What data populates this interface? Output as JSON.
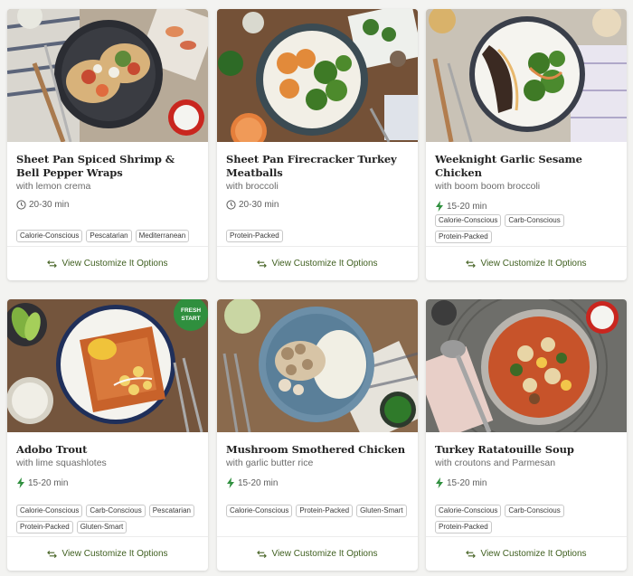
{
  "colors": {
    "accent_green": "#4a6628",
    "bolt_green": "#2f8f3e",
    "tag_border": "#c9c9c9"
  },
  "recipes": [
    {
      "title": "Sheet Pan Spiced Shrimp & Bell Pepper Wraps",
      "subtitle": "with lemon crema",
      "time": "20-30 min",
      "time_icon": "clock-icon",
      "tags": [
        "Calorie-Conscious",
        "Pescatarian",
        "Mediterranean"
      ],
      "action": "View Customize It Options"
    },
    {
      "title": "Sheet Pan Firecracker Turkey Meatballs",
      "subtitle": "with broccoli",
      "time": "20-30 min",
      "time_icon": "clock-icon",
      "tags": [
        "Protein-Packed"
      ],
      "action": "View Customize It Options"
    },
    {
      "title": "Weeknight Garlic Sesame Chicken",
      "subtitle": "with boom boom broccoli",
      "time": "15-20 min",
      "time_icon": "lightning-bolt-icon",
      "tags": [
        "Calorie-Conscious",
        "Carb-Conscious",
        "Protein-Packed"
      ],
      "action": "View Customize It Options"
    },
    {
      "title": "Adobo Trout",
      "subtitle": "with lime squashlotes",
      "time": "15-20 min",
      "time_icon": "lightning-bolt-icon",
      "tags": [
        "Calorie-Conscious",
        "Carb-Conscious",
        "Pescatarian",
        "Protein-Packed",
        "Gluten-Smart"
      ],
      "badge": "FRESH START",
      "action": "View Customize It Options"
    },
    {
      "title": "Mushroom Smothered Chicken",
      "subtitle": "with garlic butter rice",
      "time": "15-20 min",
      "time_icon": "lightning-bolt-icon",
      "tags": [
        "Calorie-Conscious",
        "Protein-Packed",
        "Gluten-Smart"
      ],
      "action": "View Customize It Options"
    },
    {
      "title": "Turkey Ratatouille Soup",
      "subtitle": "with croutons and Parmesan",
      "time": "15-20 min",
      "time_icon": "lightning-bolt-icon",
      "tags": [
        "Calorie-Conscious",
        "Carb-Conscious",
        "Protein-Packed"
      ],
      "action": "View Customize It Options"
    }
  ]
}
